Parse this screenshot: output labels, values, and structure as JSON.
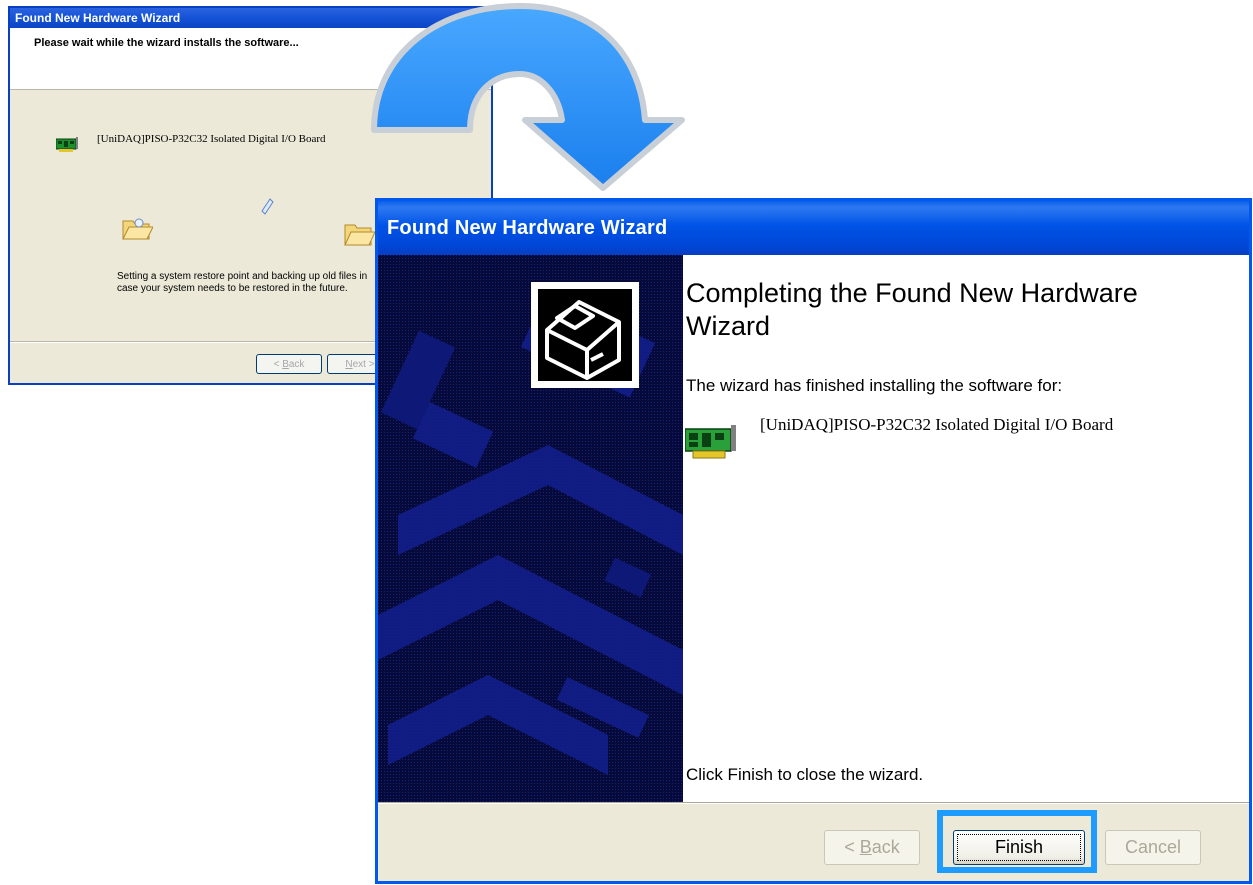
{
  "back_window": {
    "title": "Found New Hardware Wizard",
    "header": "Please wait while the wizard installs the software...",
    "device_name": "[UniDAQ]PISO-P32C32 Isolated Digital I/O Board",
    "status": "Setting a system restore point and backing up old files in case your system needs to be restored in the future.",
    "back_label_prefix": "< ",
    "back_label_key": "B",
    "back_label_rest": "ack",
    "next_label_key": "N",
    "next_label_rest": "ext >"
  },
  "front_window": {
    "title": "Found New Hardware Wizard",
    "heading": "Completing the Found New Hardware Wizard",
    "finished_text": "The wizard has finished installing the software for:",
    "device_name": "[UniDAQ]PISO-P32C32 Isolated Digital I/O Board",
    "close_hint": "Click Finish to close the wizard.",
    "back_label_prefix": "< ",
    "back_label_key": "B",
    "back_label_rest": "ack",
    "finish_label": "Finish",
    "cancel_label": "Cancel"
  },
  "icons": {
    "device": "pci-card-icon",
    "arrow": "curved-arrow-icon",
    "hardware": "hardware-box-icon"
  },
  "colors": {
    "titlebar_blue": "#0053E6",
    "highlight": "#1E9BFF",
    "sidebar": "#060A3A"
  }
}
